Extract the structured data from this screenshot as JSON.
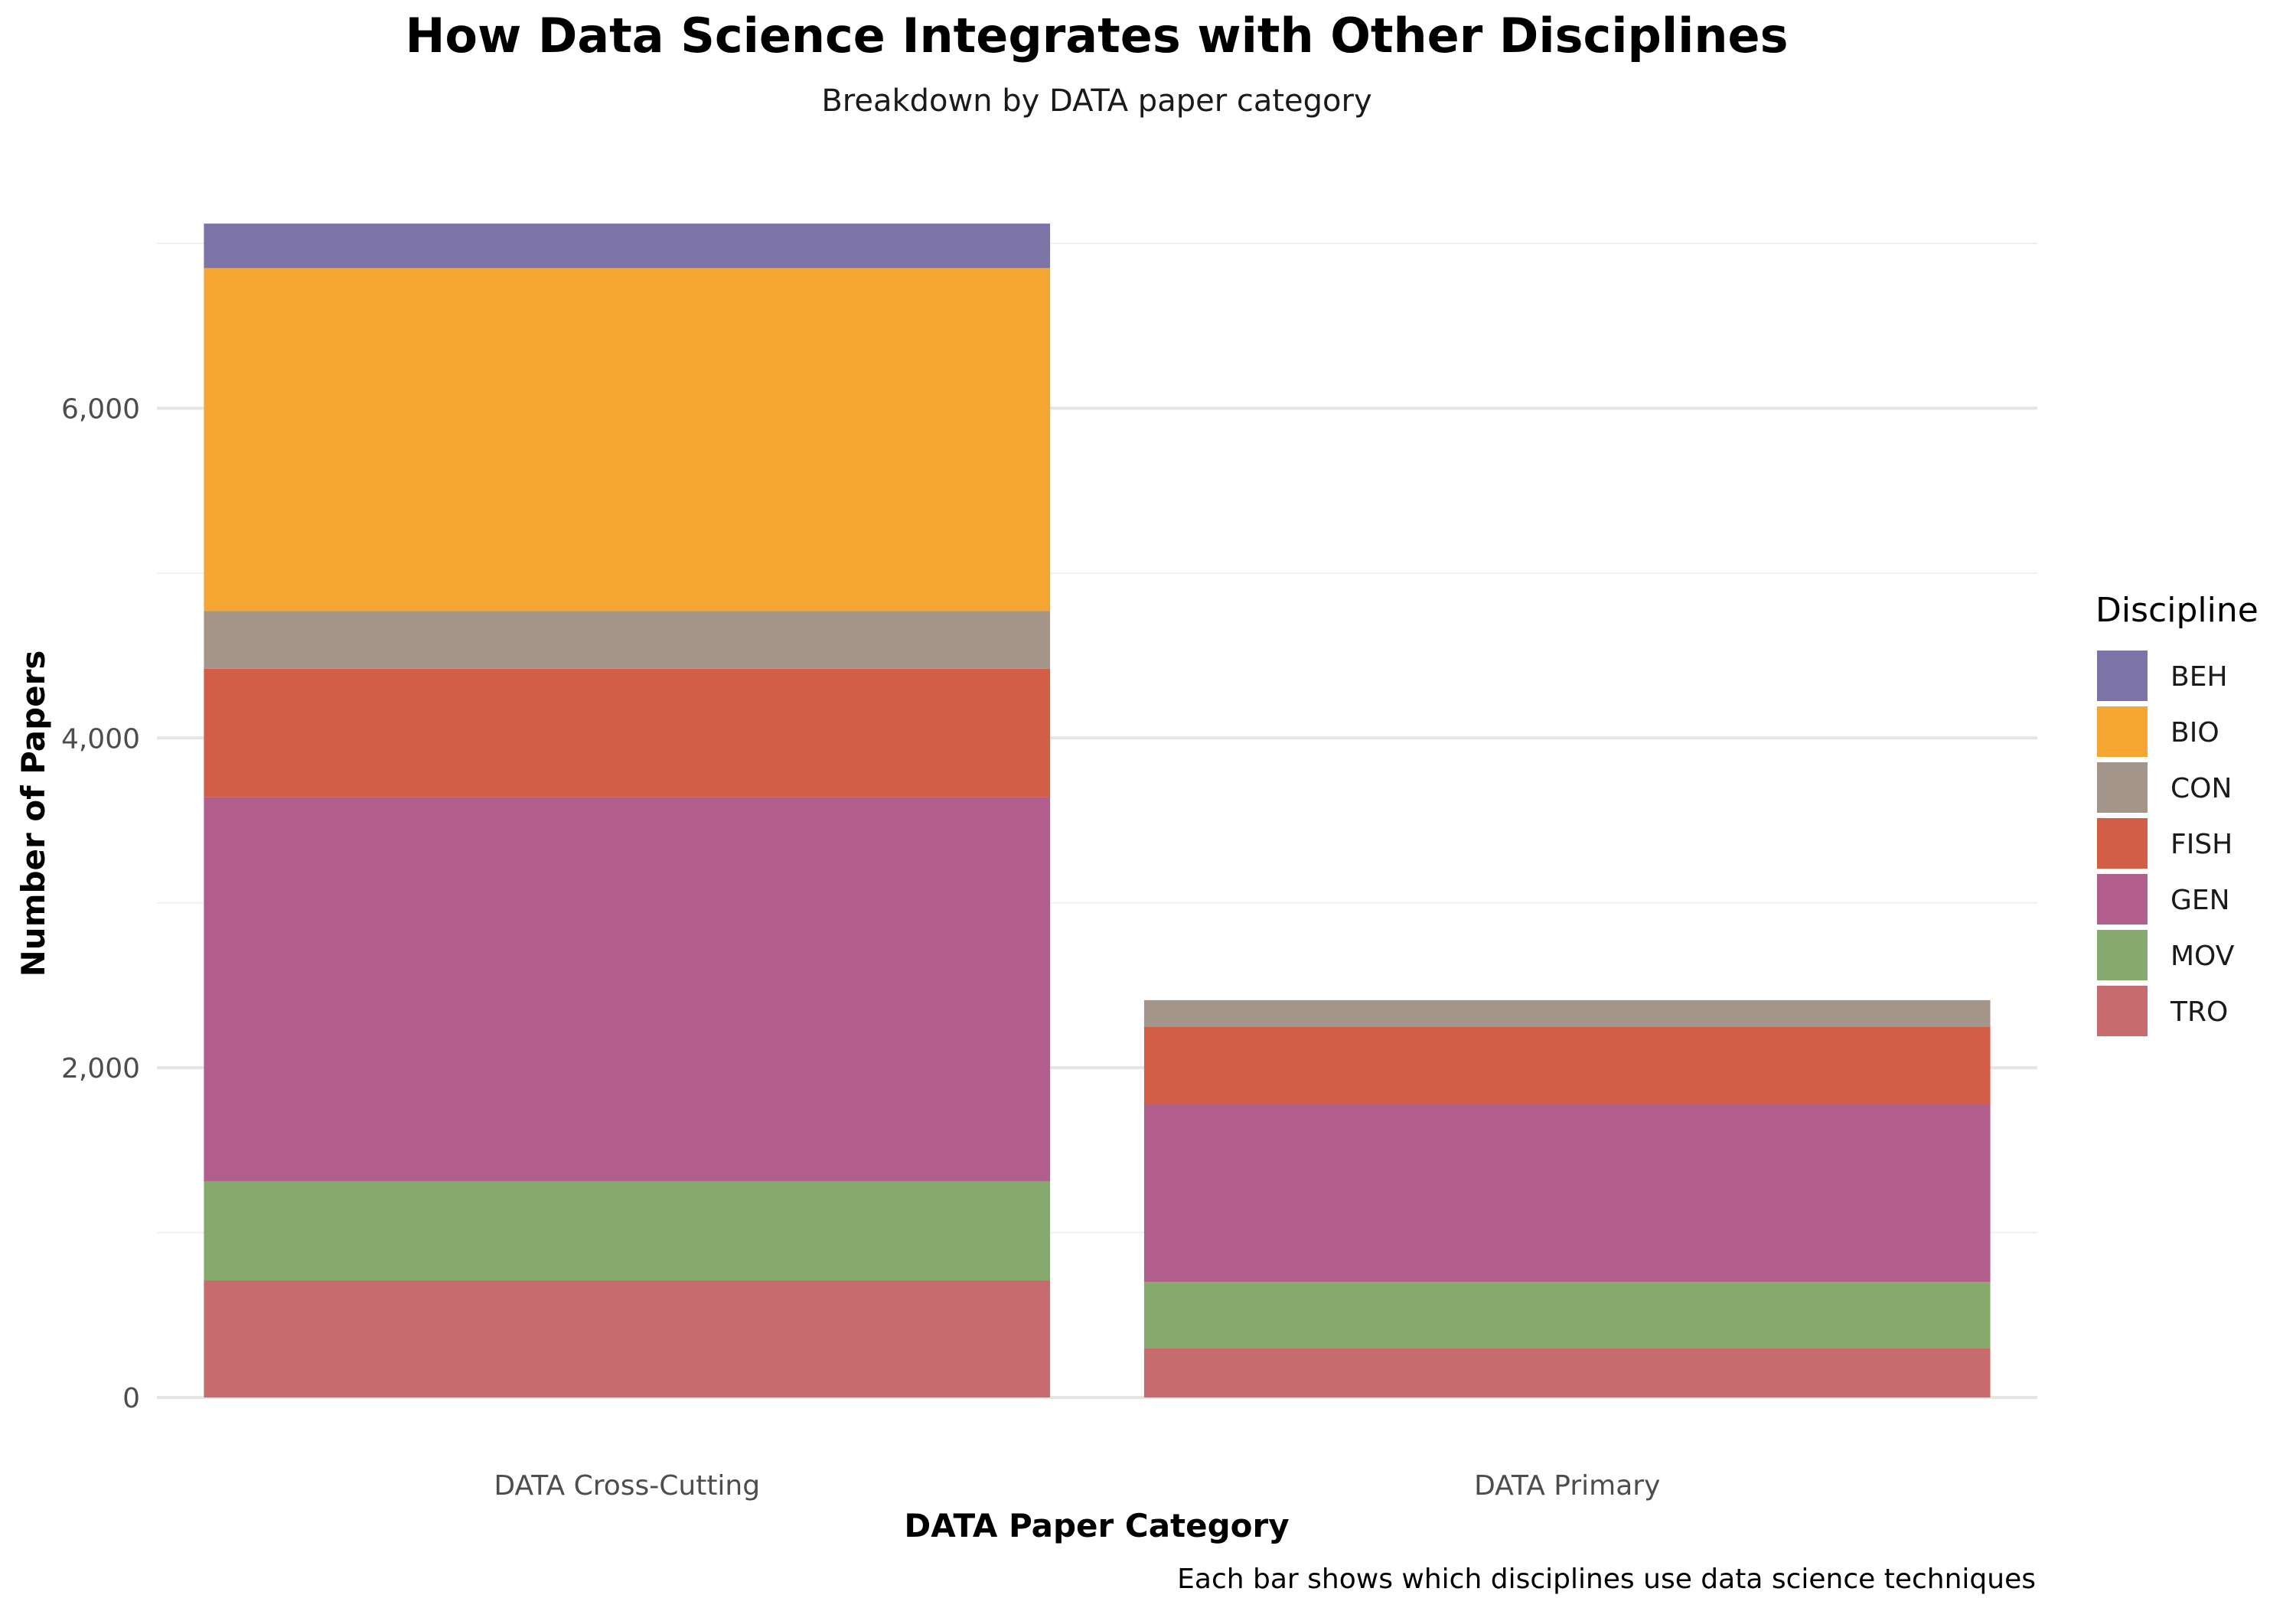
{
  "chart_data": {
    "type": "bar",
    "stacked": true,
    "title": "How Data Science Integrates with Other Disciplines",
    "subtitle": "Breakdown by DATA paper category",
    "xlabel": "DATA Paper Category",
    "ylabel": "Number of Papers",
    "caption": "Each bar shows which disciplines use data science techniques",
    "categories": [
      "DATA Cross-Cutting",
      "DATA Primary"
    ],
    "ylim": [
      0,
      7130
    ],
    "yticks": [
      0,
      2000,
      4000,
      6000
    ],
    "ytick_labels": [
      "0",
      "2,000",
      "4,000",
      "6,000"
    ],
    "grid": true,
    "legend": {
      "title": "Discipline",
      "position": "right"
    },
    "series": [
      {
        "name": "TRO",
        "color": "#C76B6F",
        "values": [
          710,
          300
        ]
      },
      {
        "name": "MOV",
        "color": "#86AA6E",
        "values": [
          600,
          400
        ]
      },
      {
        "name": "GEN",
        "color": "#B25E8C",
        "values": [
          2330,
          1080
        ]
      },
      {
        "name": "FISH",
        "color": "#D35E46",
        "values": [
          780,
          470
        ]
      },
      {
        "name": "CON",
        "color": "#A39589",
        "values": [
          350,
          160
        ]
      },
      {
        "name": "BIO",
        "color": "#F4A532",
        "values": [
          2080,
          0
        ]
      },
      {
        "name": "BEH",
        "color": "#7C74A6",
        "values": [
          270,
          0
        ]
      }
    ]
  }
}
